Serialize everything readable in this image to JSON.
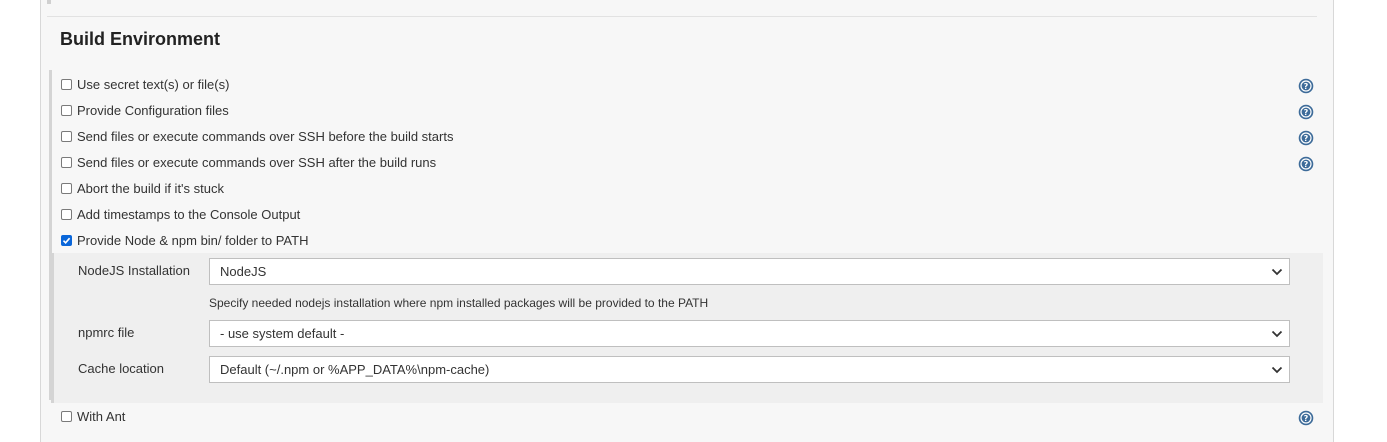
{
  "section": {
    "title": "Build Environment"
  },
  "options": [
    {
      "label": "Use secret text(s) or file(s)",
      "checked": false,
      "help": true
    },
    {
      "label": "Provide Configuration files",
      "checked": false,
      "help": true
    },
    {
      "label": "Send files or execute commands over SSH before the build starts",
      "checked": false,
      "help": true
    },
    {
      "label": "Send files or execute commands over SSH after the build runs",
      "checked": false,
      "help": true
    },
    {
      "label": "Abort the build if it's stuck",
      "checked": false,
      "help": false
    },
    {
      "label": "Add timestamps to the Console Output",
      "checked": false,
      "help": false
    },
    {
      "label": "Provide Node & npm bin/ folder to PATH",
      "checked": true,
      "help": false
    }
  ],
  "node_config": {
    "installation": {
      "label": "NodeJS Installation",
      "value": "NodeJS",
      "hint": "Specify needed nodejs installation where npm installed packages will be provided to the PATH"
    },
    "npmrc": {
      "label": "npmrc file",
      "value": "- use system default -"
    },
    "cache": {
      "label": "Cache location",
      "value": "Default (~/.npm or %APP_DATA%\\npm-cache)"
    }
  },
  "with_ant": {
    "label": "With Ant",
    "checked": false,
    "help": true
  },
  "colors": {
    "accent": "#0a66d9",
    "help_icon": "#3d6b99",
    "panel_bg": "#f7f7f7",
    "nested_bg": "#efefef"
  },
  "icons": {
    "help": "help-icon",
    "dropdown": "chevron-down-icon",
    "check": "check-icon"
  }
}
